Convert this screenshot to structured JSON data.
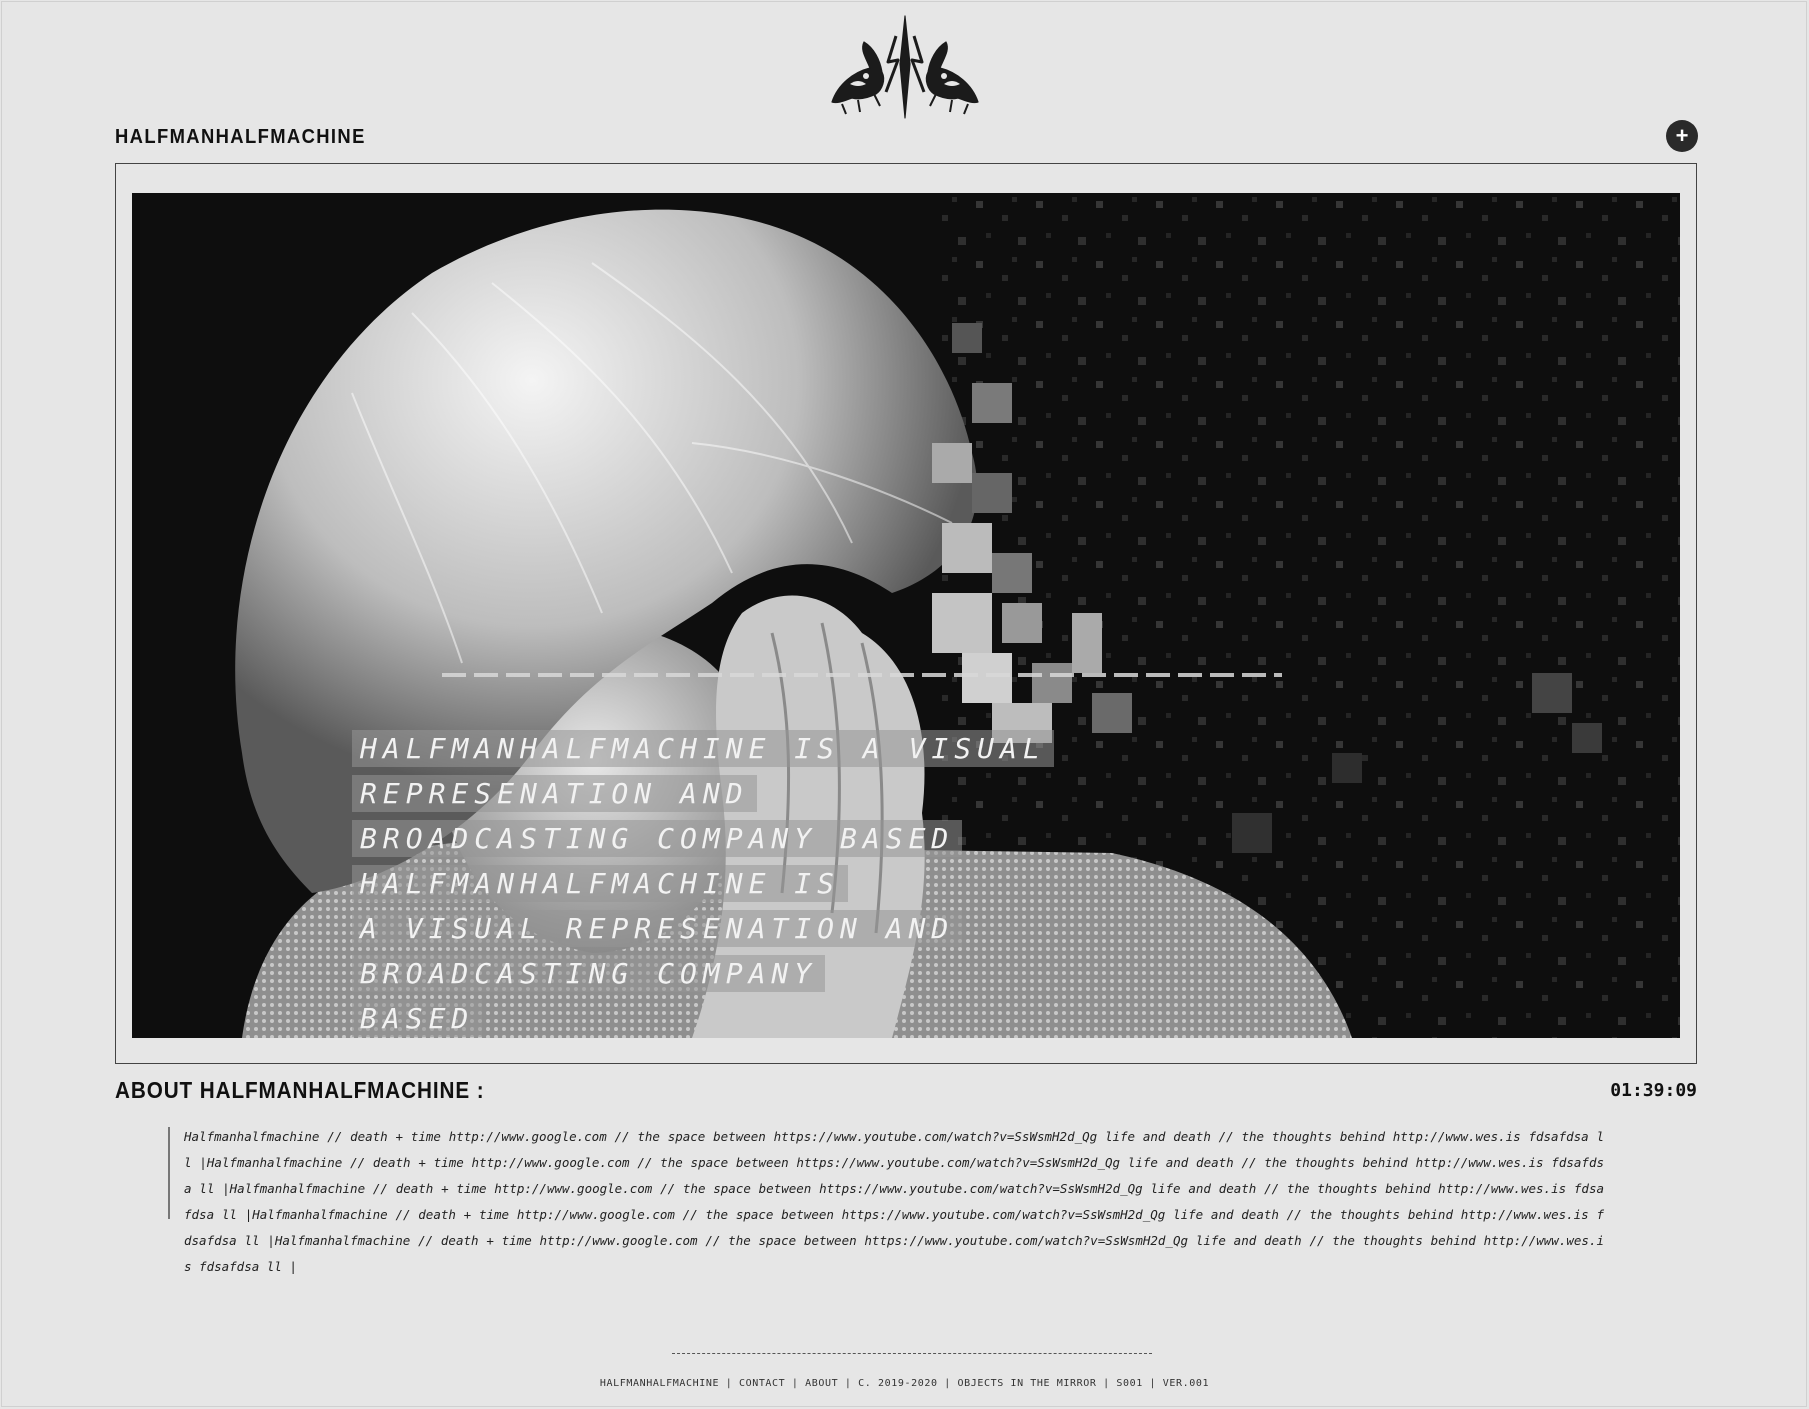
{
  "header": {
    "site_title": "HALFMANHALFMACHINE",
    "menu_button": "+"
  },
  "hero": {
    "overlay_lines": [
      "HALFMANHALFMACHINE IS A VISUAL REPRESENATION AND",
      "BROADCASTING COMPANY BASED HALFMANHALFMACHINE IS",
      "A VISUAL REPRESENATION AND BROADCASTING COMPANY",
      "BASED"
    ]
  },
  "about": {
    "title": "ABOUT HALFMANHALFMACHINE :",
    "timer": "01:39:09",
    "body": "Halfmanhalfmachine // death + time http://www.google.com // the space between  https://www.youtube.com/watch?v=SsWsmH2d_Qg life and death // the thoughts behind http://www.wes.is fdsafdsa ll |Halfmanhalfmachine // death + time http://www.google.com // the space between  https://www.youtube.com/watch?v=SsWsmH2d_Qg life and death // the thoughts behind http://www.wes.is fdsafdsa ll |Halfmanhalfmachine // death + time http://www.google.com // the space between  https://www.youtube.com/watch?v=SsWsmH2d_Qg life and death // the thoughts behind http://www.wes.is fdsafdsa ll |Halfmanhalfmachine // death + time http://www.google.com // the space between  https://www.youtube.com/watch?v=SsWsmH2d_Qg life and death // the thoughts behind http://www.wes.is fdsafdsa ll |Halfmanhalfmachine // death + time http://www.google.com // the space between  https://www.youtube.com/watch?v=SsWsmH2d_Qg life and death // the thoughts behind http://www.wes.is fdsafdsa ll |"
  },
  "footer": {
    "rule": "---------------------------------------------------------------------------",
    "items": [
      "HALFMANHALFMACHINE",
      "CONTACT",
      "ABOUT",
      "C. 2019-2020",
      "OBJECTS IN THE MIRROR",
      "S001",
      "VER.001"
    ],
    "separator": " | "
  }
}
